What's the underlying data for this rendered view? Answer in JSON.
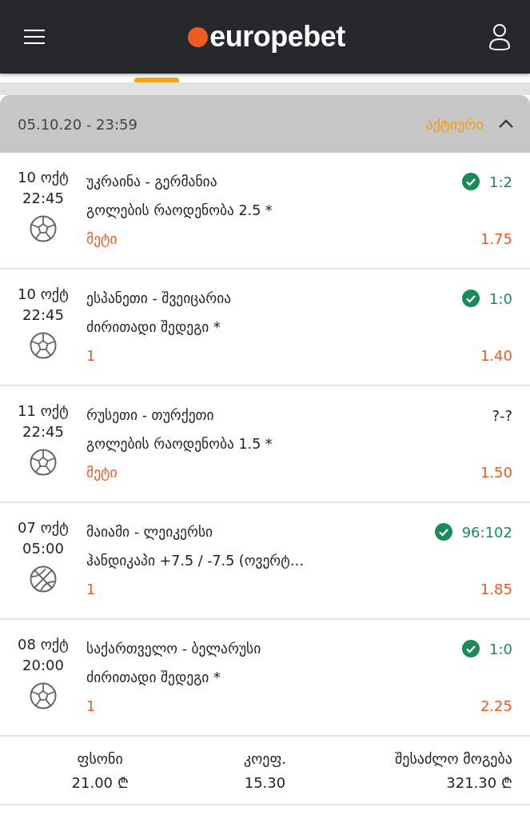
{
  "header": {
    "logo": "europebet"
  },
  "ticket": {
    "date": "05.10.20 - 23:59",
    "status": "აქტიური",
    "expanded": true,
    "bets": [
      {
        "date": "10 ოქტ",
        "time": "22:45",
        "kind": "football",
        "match": "უკრაინა - გერმანია",
        "market": "გოლების რაოდენობა 2.5 *",
        "pick": "მეტი",
        "odds": "1.75",
        "score": "1:2",
        "won": true
      },
      {
        "date": "10 ოქტ",
        "time": "22:45",
        "kind": "football",
        "match": "ესპანეთი - შვეიცარია",
        "market": "ძირითადი შედეგი *",
        "pick": "1",
        "odds": "1.40",
        "score": "1:0",
        "won": true
      },
      {
        "date": "11 ოქტ",
        "time": "22:45",
        "kind": "football",
        "match": "რუსეთი - თურქეთი",
        "market": "გოლების რაოდენობა 1.5 *",
        "pick": "მეტი",
        "odds": "1.50",
        "score": "?-?",
        "won": false
      },
      {
        "date": "07 ოქტ",
        "time": "05:00",
        "kind": "basketball",
        "match": "მაიამი - ლეიკერსი",
        "market": "ჰანდიკაპი +7.5 / -7.5 (ოვერტ…",
        "pick": "1",
        "odds": "1.85",
        "score": "96:102",
        "won": true
      },
      {
        "date": "08 ოქტ",
        "time": "20:00",
        "kind": "football",
        "match": "საქართველო - ბელარუსი",
        "market": "ძირითადი შედეგი *",
        "pick": "1",
        "odds": "2.25",
        "score": "1:0",
        "won": true
      }
    ],
    "summary": [
      {
        "label": "ფსონი",
        "value": "21.00 ₾"
      },
      {
        "label": "კოეფ.",
        "value": "15.30"
      },
      {
        "label": "შესაძლო მოგება",
        "value": "321.30 ₾"
      }
    ]
  }
}
